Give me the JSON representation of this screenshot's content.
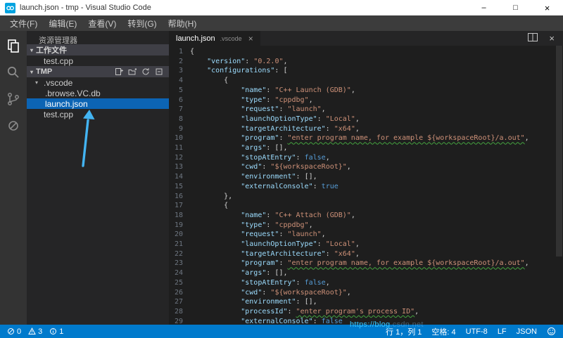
{
  "window": {
    "title": "launch.json - tmp - Visual Studio Code",
    "controls": {
      "minimize": "–",
      "maximize": "□",
      "close": "×"
    }
  },
  "menu": {
    "items": [
      "文件(F)",
      "编辑(E)",
      "查看(V)",
      "转到(G)",
      "帮助(H)"
    ]
  },
  "activity_bar": {
    "icons": [
      "explorer-icon",
      "search-icon",
      "git-icon",
      "debug-icon"
    ]
  },
  "sidebar": {
    "title": "资源管理器",
    "working_files": {
      "label": "工作文件",
      "items": [
        "test.cpp"
      ]
    },
    "folder": {
      "label": "TMP",
      "actions": [
        "new-file-icon",
        "new-folder-icon",
        "refresh-icon",
        "collapse-all-icon"
      ],
      "tree": [
        {
          "name": ".vscode",
          "type": "folder",
          "level": 0,
          "selected": false
        },
        {
          "name": ".browse.VC.db",
          "type": "file",
          "level": 1,
          "selected": false
        },
        {
          "name": "launch.json",
          "type": "file",
          "level": 1,
          "selected": true
        },
        {
          "name": "test.cpp",
          "type": "file",
          "level": 0,
          "selected": false
        }
      ]
    }
  },
  "editor": {
    "tab": {
      "name": "launch.json",
      "detail": ".vscode"
    },
    "code": {
      "lines": [
        "{",
        "    \"version\": \"0.2.0\",",
        "    \"configurations\": [",
        "        {",
        "            \"name\": \"C++ Launch (GDB)\",",
        "            \"type\": \"cppdbg\",",
        "            \"request\": \"launch\",",
        "            \"launchOptionType\": \"Local\",",
        "            \"targetArchitecture\": \"x64\",",
        "            \"program\": \"enter program name, for example ${workspaceRoot}/a.out\",",
        "            \"args\": [],",
        "            \"stopAtEntry\": false,",
        "            \"cwd\": \"${workspaceRoot}\",",
        "            \"environment\": [],",
        "            \"externalConsole\": true",
        "        },",
        "        {",
        "            \"name\": \"C++ Attach (GDB)\",",
        "            \"type\": \"cppdbg\",",
        "            \"request\": \"launch\",",
        "            \"launchOptionType\": \"Local\",",
        "            \"targetArchitecture\": \"x64\",",
        "            \"program\": \"enter program name, for example ${workspaceRoot}/a.out\",",
        "            \"args\": [],",
        "            \"stopAtEntry\": false,",
        "            \"cwd\": \"${workspaceRoot}\",",
        "            \"environment\": [],",
        "            \"processId\": \"enter program's process ID\",",
        "            \"externalConsole\": false"
      ],
      "warn_value_lines": [
        10,
        23,
        28
      ]
    }
  },
  "status_bar": {
    "errors": "0",
    "warnings": "3",
    "infos": "1",
    "cursor": "行 1，列 1",
    "indent": "空格: 4",
    "encoding": "UTF-8",
    "eol": "LF",
    "language": "JSON"
  },
  "watermark": {
    "strong": "https://blog",
    "faint": ".csdn.net"
  },
  "colors": {
    "accent": "#007acc",
    "selection": "#0c64b4",
    "arrow": "#43b4f2",
    "key": "#9cdcfe",
    "string": "#ce9178",
    "keyword": "#569cd6",
    "warn": "#44a33f"
  }
}
